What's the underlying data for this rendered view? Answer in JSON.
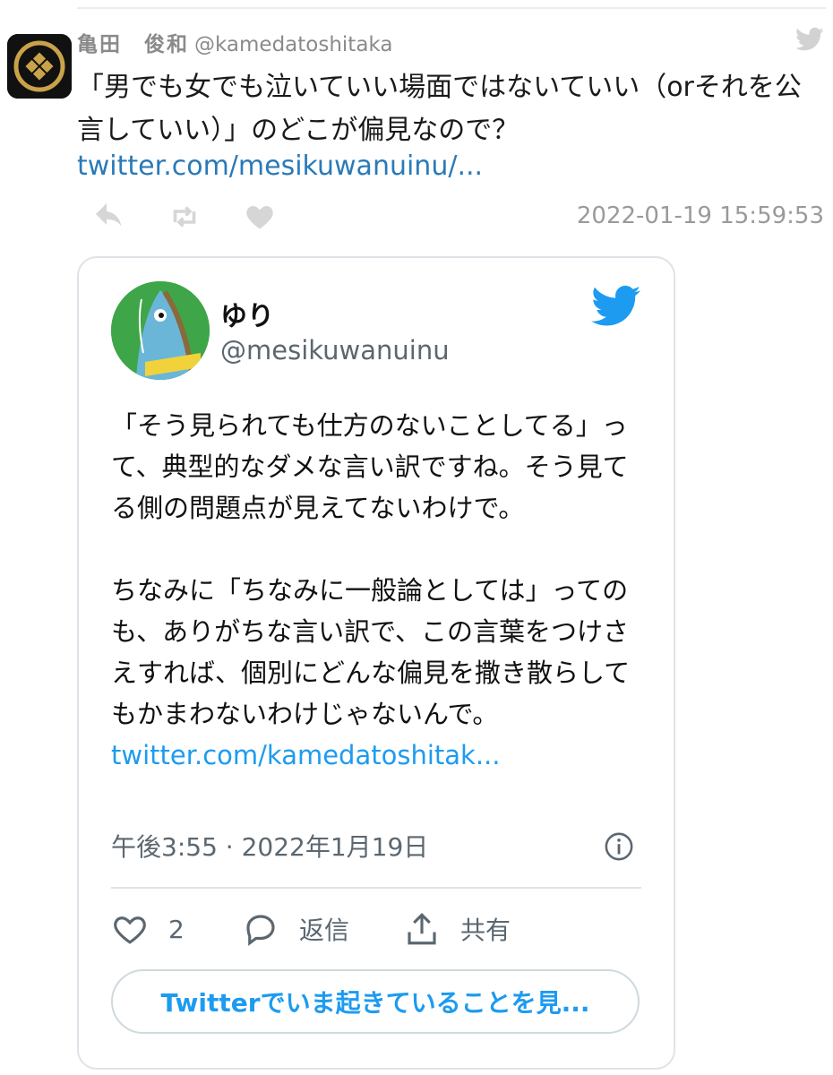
{
  "tweet": {
    "author_name": "亀田　俊和",
    "author_handle": "@kamedatoshitaka",
    "text": "「男でも女でも泣いていい場面ではないていい（orそれを公言していい）」のどこが偏見なので？",
    "link_text": "twitter.com/mesikuwanuinu/...",
    "timestamp": "2022-01-19 15:59:53",
    "icons": [
      "reply-icon",
      "retweet-icon",
      "like-icon",
      "twitter-bird-icon"
    ]
  },
  "embed": {
    "author_name": "ゆり",
    "author_handle": "@mesikuwanuinu",
    "text_part1": "「そう見られても仕方のないことしてる」って、典型的なダメな言い訳ですね。そう見てる側の問題点が見えてないわけで。\n\nちなみに「ちなみに一般論としては」ってのも、ありがちな言い訳で、この言葉をつけさえすれば、個別にどんな偏見を撒き散らしてもかまわないわけじゃないんで。 ",
    "text_link": "twitter.com/kamedatoshitak...",
    "meta": "午後3:55 · 2022年1月19日",
    "like_count": "2",
    "reply_label": "返信",
    "share_label": "共有",
    "cta_label": "Twitterでいま起きていることを見...",
    "colors": {
      "accent": "#1d9bf0",
      "avatar_bg": "#3ea548"
    }
  }
}
